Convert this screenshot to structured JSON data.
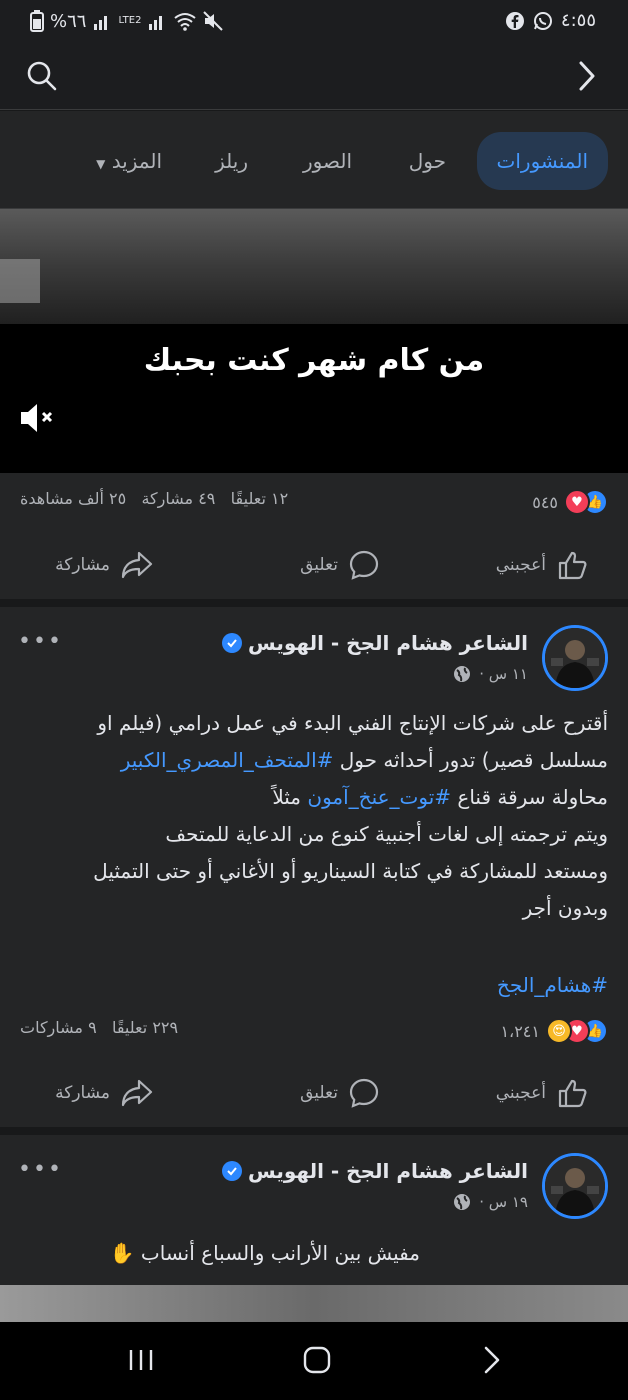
{
  "status": {
    "time": "٤:٥٥",
    "battery": "%٦٦",
    "network": "LTE2"
  },
  "tabs": [
    {
      "label": "المنشورات"
    },
    {
      "label": "حول"
    },
    {
      "label": "الصور"
    },
    {
      "label": "ريلز"
    },
    {
      "label": "المزيد"
    }
  ],
  "video": {
    "caption": "من كام شهر كنت بحبك"
  },
  "video_stats": {
    "reactions": "٥٤٥",
    "comments": "١٢ تعليقًا",
    "shares": "٤٩ مشاركة",
    "views": "٢٥ ألف مشاهدة"
  },
  "actions": {
    "like": "أعجبني",
    "comment": "تعليق",
    "share": "مشاركة"
  },
  "post1": {
    "author": "الشاعر هشام الجخ - الهويس",
    "time": "١١ س ·",
    "line1": "أقترح على شركات الإنتاج الفني البدء في عمل درامي (فيلم او",
    "line2_text": "مسلسل قصير) تدور أحداثه حول ",
    "line2_tag": "#المتحف_المصري_الكبير",
    "line3_text": "محاولة سرقة قناع ",
    "line3_tag": "#توت_عنخ_آمون",
    "line3_end": " مثلاً",
    "line4": "ويتم ترجمته إلى لغات أجنبية  كنوع من الدعاية للمتحف",
    "line5": "ومستعد للمشاركة في كتابة السيناريو أو الأغاني أو حتى التمثيل",
    "line6": "وبدون أجر",
    "hashtag": "#هشام_الجخ",
    "reactions": "١،٢٤١",
    "comments": "٢٢٩ تعليقًا",
    "shares": "٩ مشاركات"
  },
  "post2": {
    "author": "الشاعر هشام الجخ - الهويس",
    "time": "١٩ س ·",
    "text": "مفيش بين الأرانب والسباع أنساب"
  },
  "colors": {
    "accent": "#4599ff",
    "like": "#2d88ff",
    "love": "#f33e58",
    "bg": "#18191a",
    "card": "#242526"
  }
}
